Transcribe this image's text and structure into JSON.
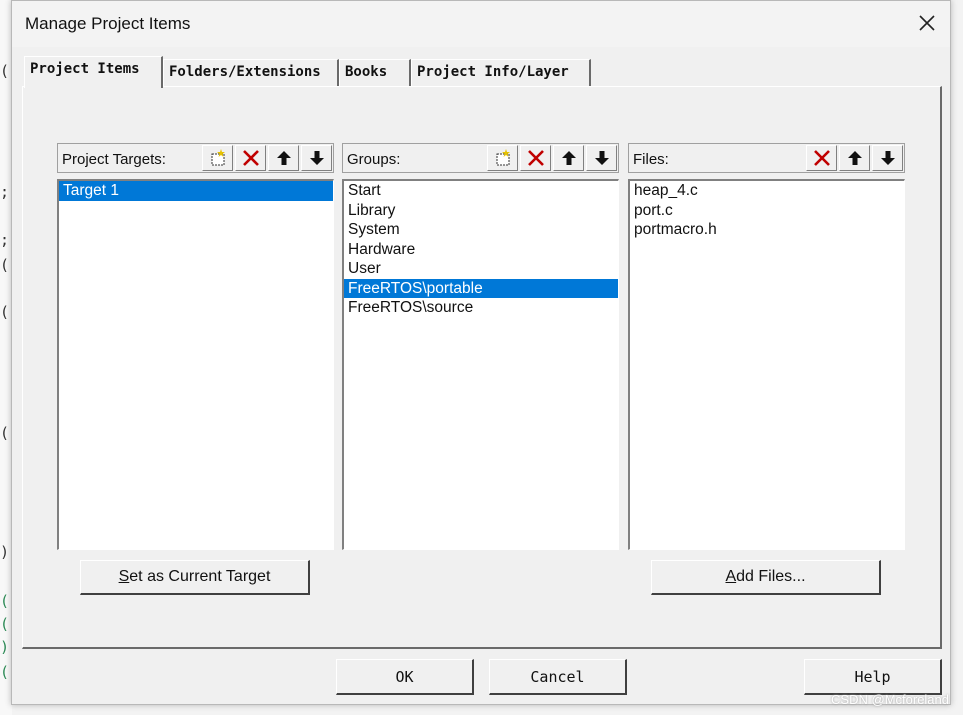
{
  "dialog": {
    "title": "Manage Project Items"
  },
  "tabs": [
    {
      "label": "Project Items",
      "active": true
    },
    {
      "label": "Folders/Extensions",
      "active": false
    },
    {
      "label": "Books",
      "active": false
    },
    {
      "label": "Project Info/Layer",
      "active": false
    }
  ],
  "targets": {
    "label": "Project Targets:",
    "items": [
      "Target 1"
    ],
    "selected_index": 0,
    "set_current_label": "Set as Current Target",
    "set_current_mnemonic": "S",
    "set_current_rest": "et as Current Target"
  },
  "groups": {
    "label": "Groups:",
    "items": [
      "Start",
      "Library",
      "System",
      "Hardware",
      "User",
      "FreeRTOS\\portable",
      "FreeRTOS\\source"
    ],
    "selected_index": 5
  },
  "files": {
    "label": "Files:",
    "items": [
      "heap_4.c",
      "port.c",
      "portmacro.h"
    ],
    "add_files_label": "Add Files...",
    "add_files_mnemonic": "A",
    "add_files_rest": "dd Files..."
  },
  "buttons": {
    "ok": "OK",
    "cancel": "Cancel",
    "help": "Help"
  },
  "watermark": "CSDN @Mcforeland",
  "colors": {
    "selection": "#0078d7",
    "delete_icon": "#c00000",
    "new_icon": "#e6c200"
  }
}
